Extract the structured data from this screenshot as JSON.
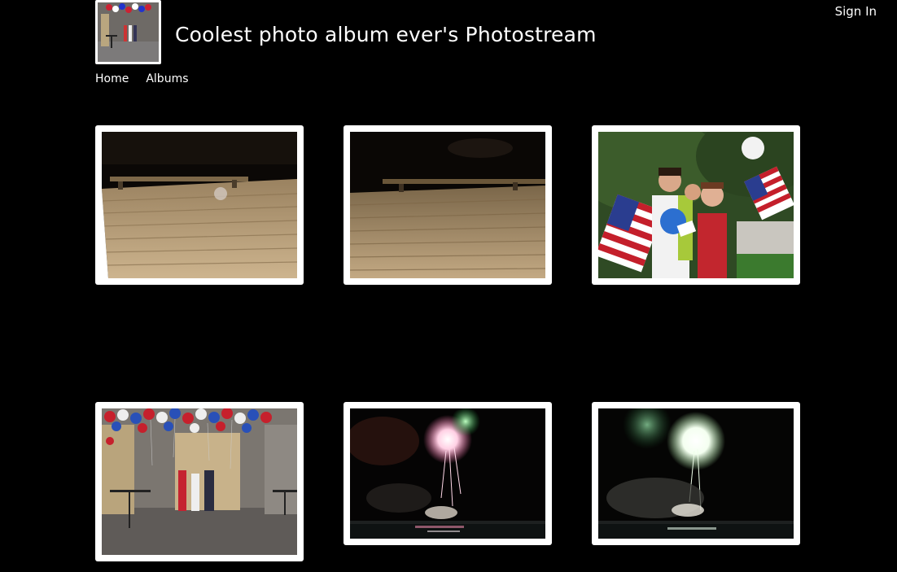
{
  "header": {
    "title": "Coolest photo album ever's Photostream",
    "sign_in_label": "Sign In"
  },
  "nav": {
    "items": [
      {
        "label": "Home"
      },
      {
        "label": "Albums"
      }
    ]
  },
  "colors": {
    "background": "#000000",
    "text": "#ffffff",
    "frame": "#ffffff"
  },
  "photos": [
    {
      "subject": "wooden-deck-night"
    },
    {
      "subject": "wooden-deck-dark"
    },
    {
      "subject": "people-with-flags"
    },
    {
      "subject": "room-with-balloons"
    },
    {
      "subject": "fireworks-over-water"
    },
    {
      "subject": "fireworks-smoke-over-water"
    }
  ]
}
